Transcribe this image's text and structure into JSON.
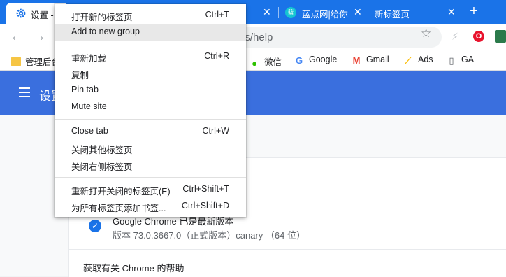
{
  "tabs": {
    "active_title": "设置 -",
    "second_title": "蓝点网|给你",
    "second_icon_text": "蓝",
    "third_title": "新标签页",
    "close_symbol": "✕",
    "new_tab_symbol": "+"
  },
  "toolbar": {
    "back": "←",
    "forward": "→",
    "url_suffix": "gs/help",
    "star": "☆"
  },
  "bookmarks": [
    {
      "label": "管理后台",
      "icon": "folder-icon"
    },
    {
      "label": "微信",
      "icon": "wechat-icon"
    },
    {
      "label": "Google",
      "icon": "google-icon"
    },
    {
      "label": "Gmail",
      "icon": "gmail-icon"
    },
    {
      "label": "Ads",
      "icon": "ads-icon"
    },
    {
      "label": "GA",
      "icon": "page-icon"
    }
  ],
  "settings": {
    "title": "设置",
    "version_line1": "Google Chrome 已是最新版本",
    "version_line2": "版本 73.0.3667.0（正式版本）canary （64 位）",
    "help_link": "获取有关 Chrome 的帮助"
  },
  "menu": {
    "items": [
      {
        "label": "打开新的标签页",
        "shortcut": "Ctrl+T"
      },
      {
        "label": "Add to new group",
        "shortcut": ""
      },
      {
        "label": "重新加载",
        "shortcut": "Ctrl+R"
      },
      {
        "label": "复制",
        "shortcut": ""
      },
      {
        "label": "Pin tab",
        "shortcut": ""
      },
      {
        "label": "Mute site",
        "shortcut": ""
      },
      {
        "label": "Close tab",
        "shortcut": "Ctrl+W"
      },
      {
        "label": "关闭其他标签页",
        "shortcut": ""
      },
      {
        "label": "关闭右侧标签页",
        "shortcut": ""
      },
      {
        "label": "重新打开关闭的标签页(E)",
        "shortcut": "Ctrl+Shift+T"
      },
      {
        "label": "为所有标签页添加书签...",
        "shortcut": "Ctrl+Shift+D"
      }
    ]
  },
  "colors": {
    "tabstrip": "#1a73e8",
    "appbar": "#3a6fde",
    "menu_highlight": "#e8e8e8"
  }
}
